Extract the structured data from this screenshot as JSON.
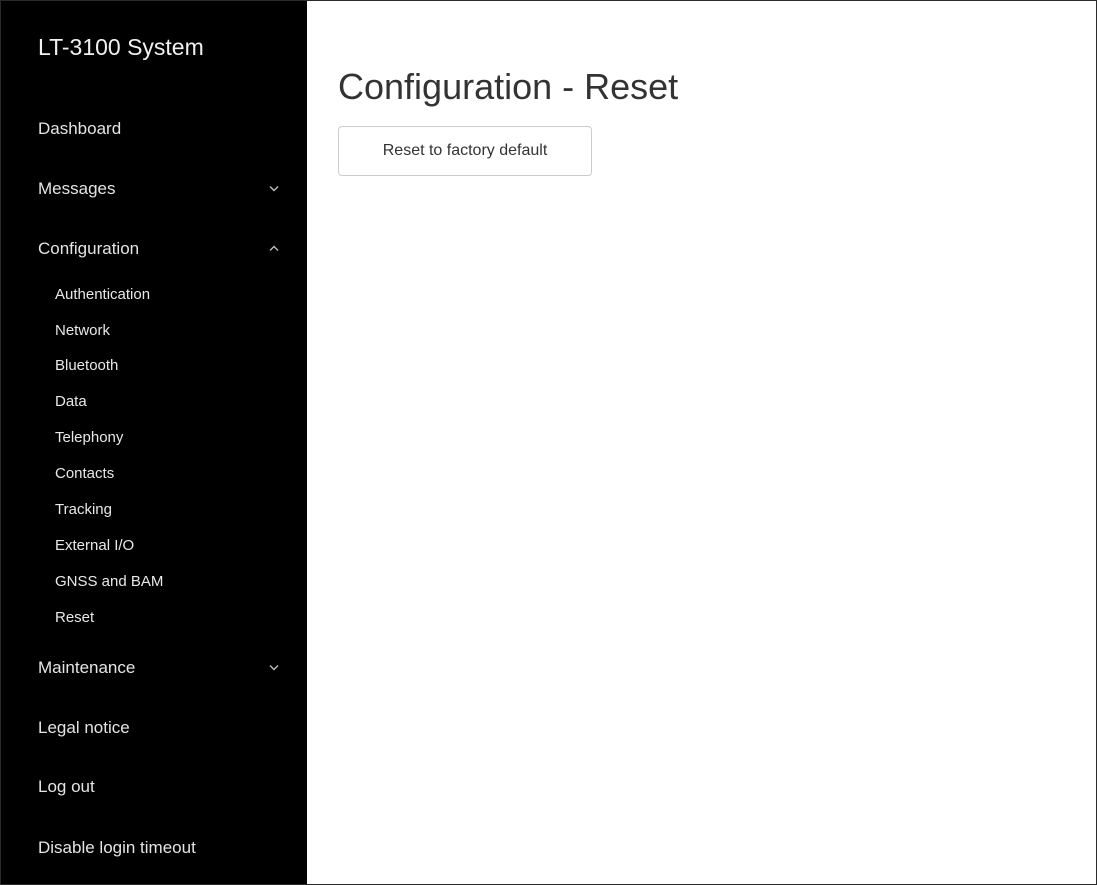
{
  "sidebar": {
    "brand": "LT-3100 System",
    "dashboard": "Dashboard",
    "messages": {
      "label": "Messages",
      "icon": "chevron-down-icon"
    },
    "configuration": {
      "label": "Configuration",
      "icon": "chevron-up-icon",
      "items": [
        {
          "label": "Authentication"
        },
        {
          "label": "Network"
        },
        {
          "label": "Bluetooth"
        },
        {
          "label": "Data"
        },
        {
          "label": "Telephony"
        },
        {
          "label": "Contacts"
        },
        {
          "label": "Tracking"
        },
        {
          "label": "External I/O"
        },
        {
          "label": "GNSS and BAM"
        },
        {
          "label": "Reset"
        }
      ]
    },
    "maintenance": {
      "label": "Maintenance",
      "icon": "chevron-down-icon"
    },
    "legal_notice": "Legal notice",
    "log_out": "Log out",
    "disable_login_timeout": "Disable login timeout"
  },
  "main": {
    "title": "Configuration - Reset",
    "reset_button": "Reset to factory default"
  },
  "colors": {
    "sidebar_background": "#000000",
    "sidebar_text": "#e6e6e6",
    "title_text": "#333333",
    "button_border": "#cccccc"
  }
}
